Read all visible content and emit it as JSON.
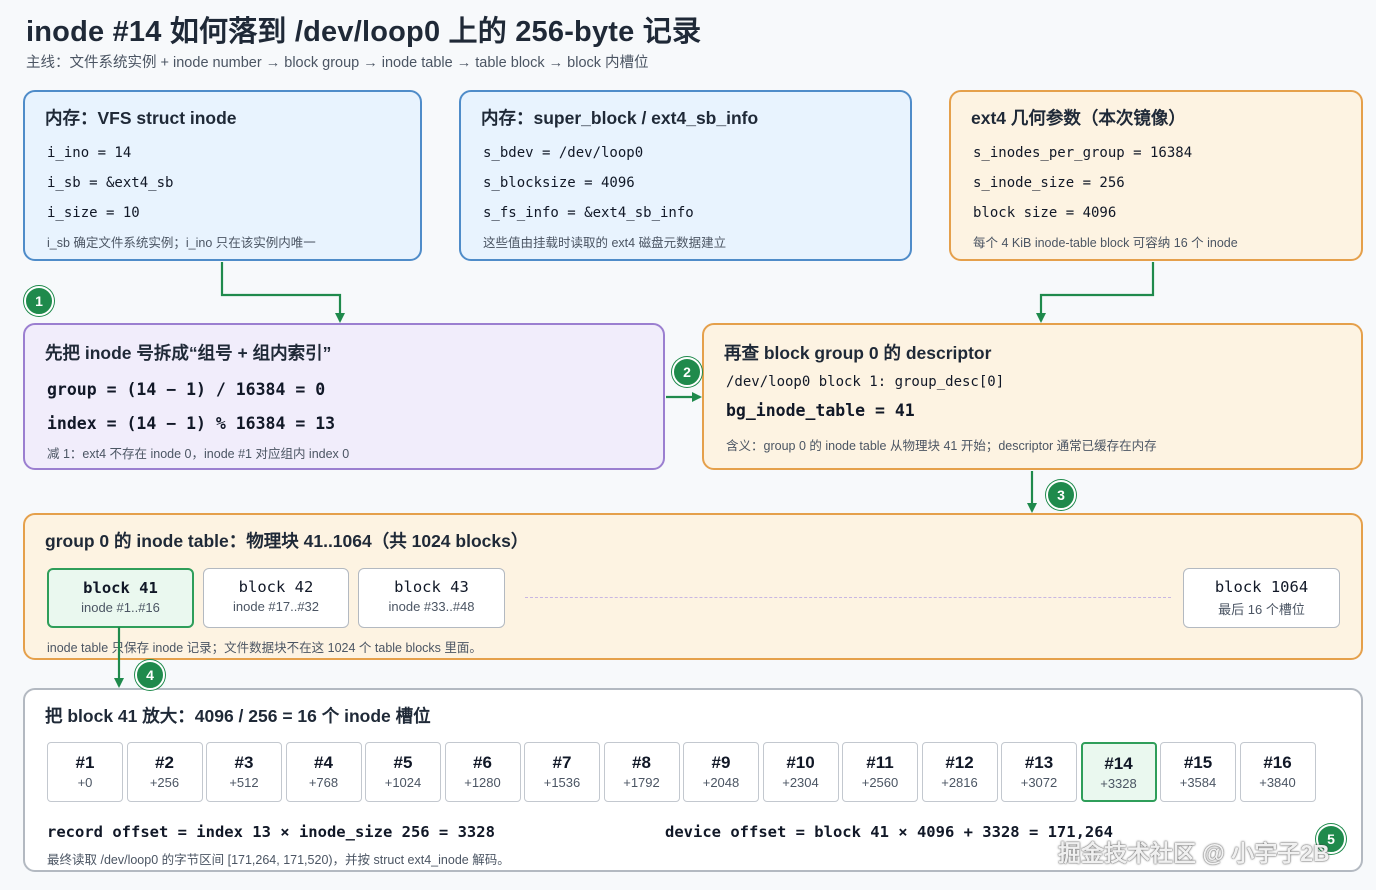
{
  "title": "inode #14 如何落到 /dev/loop0 上的 256-byte 记录",
  "subtitle": "主线：文件系统实例 + inode number → block group → inode table → table block → block 内槽位",
  "vfs_box": {
    "title": "内存：VFS struct inode",
    "lines": [
      "i_ino = 14",
      "i_sb = &ext4_sb",
      "i_size = 10"
    ],
    "note": "i_sb 确定文件系统实例；i_ino 只在该实例内唯一"
  },
  "sb_box": {
    "title": "内存：super_block / ext4_sb_info",
    "lines": [
      "s_bdev = /dev/loop0",
      "s_blocksize = 4096",
      "s_fs_info = &ext4_sb_info"
    ],
    "note": "这些值由挂载时读取的 ext4 磁盘元数据建立"
  },
  "geo_box": {
    "title": "ext4 几何参数（本次镜像）",
    "lines": [
      "s_inodes_per_group = 16384",
      "s_inode_size = 256",
      "block size = 4096"
    ],
    "note": "每个 4 KiB inode-table block 可容纳 16 个 inode"
  },
  "split_box": {
    "title": "先把 inode 号拆成“组号 + 组内索引”",
    "lines": [
      "group = (14 − 1) / 16384 = 0",
      "index = (14 − 1) % 16384 = 13"
    ],
    "note": "减 1：ext4 不存在 inode 0，inode #1 对应组内 index 0"
  },
  "desc_box": {
    "title": "再查 block group 0 的 descriptor",
    "line1": "/dev/loop0 block 1: group_desc[0]",
    "line2": "bg_inode_table = 41",
    "note": "含义：group 0 的 inode table 从物理块 41 开始；descriptor 通常已缓存在内存"
  },
  "table_box": {
    "title": "group 0 的 inode table：物理块 41..1064（共 1024 blocks）",
    "blocks": [
      {
        "name": "block 41",
        "sub": "inode #1..#16"
      },
      {
        "name": "block 42",
        "sub": "inode #17..#32"
      },
      {
        "name": "block 43",
        "sub": "inode #33..#48"
      },
      {
        "name": "block 1064",
        "sub": "最后 16 个槽位"
      }
    ],
    "note": "inode table 只保存 inode 记录；文件数据块不在这 1024 个 table blocks 里面。"
  },
  "zoom_box": {
    "title": "把 block 41 放大：4096 / 256 = 16 个 inode 槽位",
    "slots": [
      {
        "n": "#1",
        "off": "+0"
      },
      {
        "n": "#2",
        "off": "+256"
      },
      {
        "n": "#3",
        "off": "+512"
      },
      {
        "n": "#4",
        "off": "+768"
      },
      {
        "n": "#5",
        "off": "+1024"
      },
      {
        "n": "#6",
        "off": "+1280"
      },
      {
        "n": "#7",
        "off": "+1536"
      },
      {
        "n": "#8",
        "off": "+1792"
      },
      {
        "n": "#9",
        "off": "+2048"
      },
      {
        "n": "#10",
        "off": "+2304"
      },
      {
        "n": "#11",
        "off": "+2560"
      },
      {
        "n": "#12",
        "off": "+2816"
      },
      {
        "n": "#13",
        "off": "+3072"
      },
      {
        "n": "#14",
        "off": "+3328"
      },
      {
        "n": "#15",
        "off": "+3584"
      },
      {
        "n": "#16",
        "off": "+3840"
      }
    ],
    "record_offset": "record offset = index 13 × inode_size 256 = 3328",
    "device_offset": "device offset = block 41 × 4096 + 3328 = 171,264",
    "note": "最终读取 /dev/loop0 的字节区间 [171,264, 171,520)，并按 struct ext4_inode 解码。"
  },
  "badges": [
    "1",
    "2",
    "3",
    "4",
    "5"
  ],
  "watermark": "掘金技术社区 @ 小宇子2B",
  "colors": {
    "arrow": "#1f8a4c",
    "blue_border": "#4f8cc9",
    "orange_border": "#e5a04b",
    "purple_border": "#9b7fd0",
    "highlight": "#2f9e5a"
  }
}
